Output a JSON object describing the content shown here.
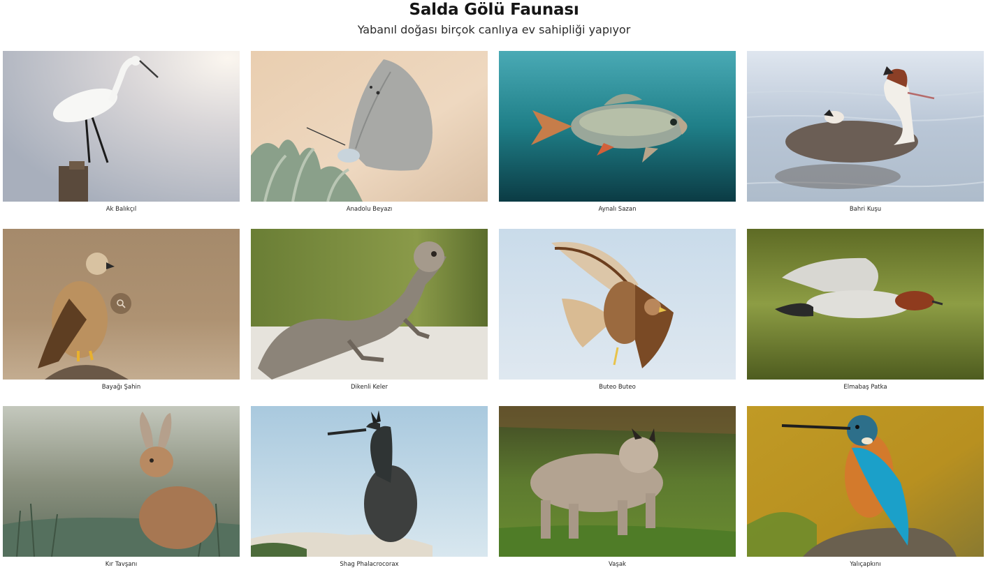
{
  "header": {
    "title": "Salda Gölü Faunası",
    "subtitle": "Yabanıl doğası birçok canlıya ev sahipliği yapıyor"
  },
  "gallery": {
    "items": [
      {
        "caption": "Ak Balıkçıl",
        "icon": "egret-photo"
      },
      {
        "caption": "Anadolu Beyazı",
        "icon": "butterfly-photo"
      },
      {
        "caption": "Aynalı Sazan",
        "icon": "carp-photo"
      },
      {
        "caption": "Bahri Kuşu",
        "icon": "grebe-photo"
      },
      {
        "caption": "Bayağı Şahin",
        "icon": "buzzard-photo"
      },
      {
        "caption": "Dikenli Keler",
        "icon": "lizard-photo"
      },
      {
        "caption": "Buteo Buteo",
        "icon": "hawk-photo"
      },
      {
        "caption": "Elmabaş Patka",
        "icon": "pochard-photo"
      },
      {
        "caption": "Kır Tavşanı",
        "icon": "hare-photo"
      },
      {
        "caption": "Shag Phalacrocorax",
        "icon": "shag-photo"
      },
      {
        "caption": "Vaşak",
        "icon": "lynx-photo"
      },
      {
        "caption": "Yalıçapkını",
        "icon": "kingfisher-photo"
      }
    ],
    "hover_icon": "search-icon"
  },
  "colors": {
    "background": "#ffffff",
    "text": "#1a1a1a",
    "zoom_overlay": "#785f46"
  }
}
